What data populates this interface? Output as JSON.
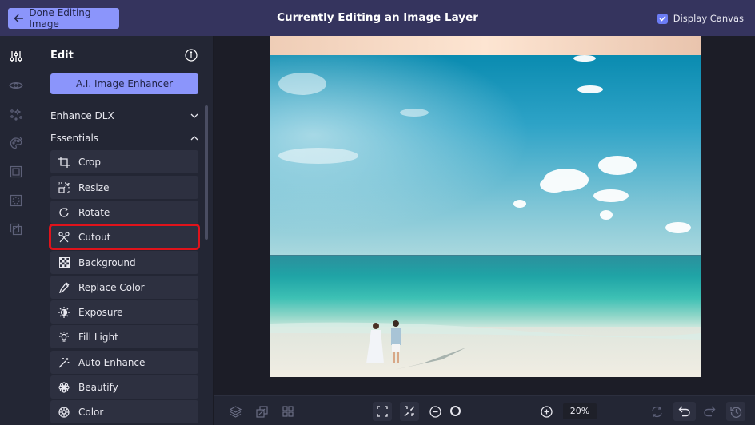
{
  "header": {
    "done_label": "Done Editing Image",
    "title": "Currently Editing an Image Layer",
    "display_canvas_label": "Display Canvas",
    "display_canvas_checked": true
  },
  "icon_rail": [
    {
      "name": "adjustments-icon",
      "active": true
    },
    {
      "name": "eye-icon",
      "active": false
    },
    {
      "name": "sparkles-icon",
      "active": false
    },
    {
      "name": "palette-icon",
      "active": false
    },
    {
      "name": "frame-icon",
      "active": false
    },
    {
      "name": "texture-icon",
      "active": false
    },
    {
      "name": "overlay-icon",
      "active": false
    }
  ],
  "panel": {
    "title": "Edit",
    "ai_button": "A.I. Image Enhancer",
    "sections": [
      {
        "label": "Enhance DLX",
        "expanded": false
      },
      {
        "label": "Essentials",
        "expanded": true
      }
    ],
    "tools": [
      {
        "label": "Crop",
        "icon": "crop-icon"
      },
      {
        "label": "Resize",
        "icon": "resize-icon"
      },
      {
        "label": "Rotate",
        "icon": "rotate-icon"
      },
      {
        "label": "Cutout",
        "icon": "scissors-icon",
        "highlighted": true
      },
      {
        "label": "Background",
        "icon": "checkerboard-icon"
      },
      {
        "label": "Replace Color",
        "icon": "eyedropper-icon"
      },
      {
        "label": "Exposure",
        "icon": "exposure-icon"
      },
      {
        "label": "Fill Light",
        "icon": "lightbulb-icon"
      },
      {
        "label": "Auto Enhance",
        "icon": "magic-wand-icon"
      },
      {
        "label": "Beautify",
        "icon": "flower-icon"
      },
      {
        "label": "Color",
        "icon": "color-wheel-icon"
      }
    ]
  },
  "bottom_bar": {
    "zoom_value": "20%",
    "zoom_level_percent": 20
  },
  "colors": {
    "accent": "#8b95fb",
    "header_bg": "#35345e",
    "highlight": "#e0131b"
  }
}
